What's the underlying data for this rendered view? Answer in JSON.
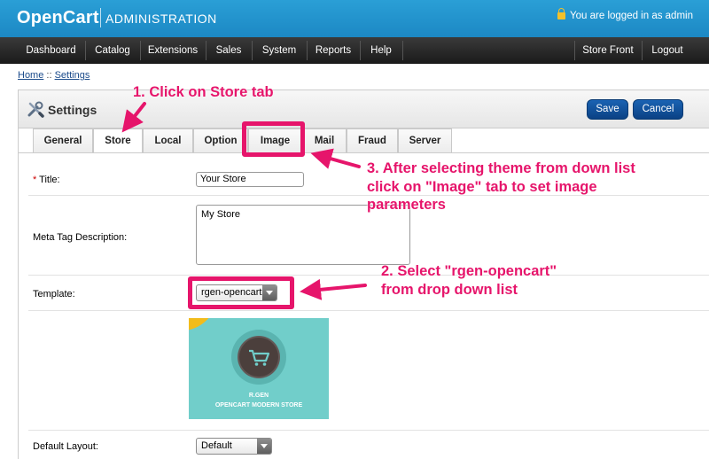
{
  "header": {
    "logo": "OpenCart",
    "subtitle": "ADMINISTRATION",
    "logged_in": "You are logged in as admin",
    "colors": {
      "header_bg": "#1e91cf",
      "accent": "#e6156b"
    }
  },
  "nav": {
    "items": [
      "Dashboard",
      "Catalog",
      "Extensions",
      "Sales",
      "System",
      "Reports",
      "Help"
    ],
    "right": [
      "Store Front",
      "Logout"
    ]
  },
  "breadcrumb": {
    "home": "Home",
    "sep": " :: ",
    "current": "Settings"
  },
  "panel": {
    "title": "Settings",
    "save": "Save",
    "cancel": "Cancel"
  },
  "tabs": [
    "General",
    "Store",
    "Local",
    "Option",
    "Image",
    "Mail",
    "Fraud",
    "Server"
  ],
  "active_tab": "Store",
  "form": {
    "title_label": "Title:",
    "title_value": "Your Store",
    "meta_label": "Meta Tag Description:",
    "meta_value": "My Store",
    "template_label": "Template:",
    "template_value": "rgen-opencart",
    "layout_label": "Default Layout:",
    "layout_value": "Default"
  },
  "preview": {
    "line1": "R.GEN",
    "line2": "OPENCART MODERN STORE"
  },
  "annotations": {
    "step1": "1.  Click on Store tab",
    "step2_l1": "2.  Select \"rgen-opencart\"",
    "step2_l2": "from drop down list",
    "step3_l1": "3.  After selecting theme from down list",
    "step3_l2": "click on \"Image\" tab to set image",
    "step3_l3": "parameters"
  }
}
